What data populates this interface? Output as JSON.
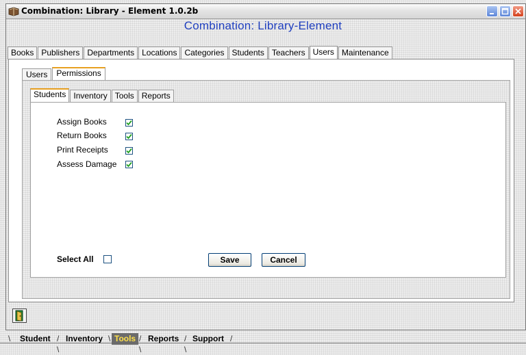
{
  "window": {
    "title": "Combination: Library - Element 1.0.2b"
  },
  "header": {
    "heading": "Combination:  Library-Element"
  },
  "main_tabs": [
    {
      "label": "Books"
    },
    {
      "label": "Publishers"
    },
    {
      "label": "Departments"
    },
    {
      "label": "Locations"
    },
    {
      "label": "Categories"
    },
    {
      "label": "Students"
    },
    {
      "label": "Teachers"
    },
    {
      "label": "Users",
      "active": true
    },
    {
      "label": "Maintenance"
    }
  ],
  "user_tabs": [
    {
      "label": "Users"
    },
    {
      "label": "Permissions",
      "active": true
    }
  ],
  "perm_tabs": [
    {
      "label": "Students",
      "active": true
    },
    {
      "label": "Inventory"
    },
    {
      "label": "Tools"
    },
    {
      "label": "Reports"
    }
  ],
  "permissions": [
    {
      "label": "Assign Books",
      "checked": true
    },
    {
      "label": "Return Books",
      "checked": true
    },
    {
      "label": "Print Receipts",
      "checked": true
    },
    {
      "label": "Assess Damage",
      "checked": true
    }
  ],
  "select_all": {
    "label": "Select All",
    "checked": false
  },
  "buttons": {
    "save": "Save",
    "cancel": "Cancel"
  },
  "bottom_tabs": [
    {
      "label": "Student"
    },
    {
      "label": "Inventory"
    },
    {
      "label": "Tools",
      "active": true
    },
    {
      "label": "Reports"
    },
    {
      "label": "Support"
    }
  ],
  "colors": {
    "heading": "#1f3fbf",
    "active_bottom_tab_bg": "#6b6b6b",
    "active_bottom_tab_text": "#ffe04a",
    "check": "#21a121"
  },
  "icons": {
    "title_icon": "library-app-icon",
    "exit_button": "door-exit-icon"
  }
}
